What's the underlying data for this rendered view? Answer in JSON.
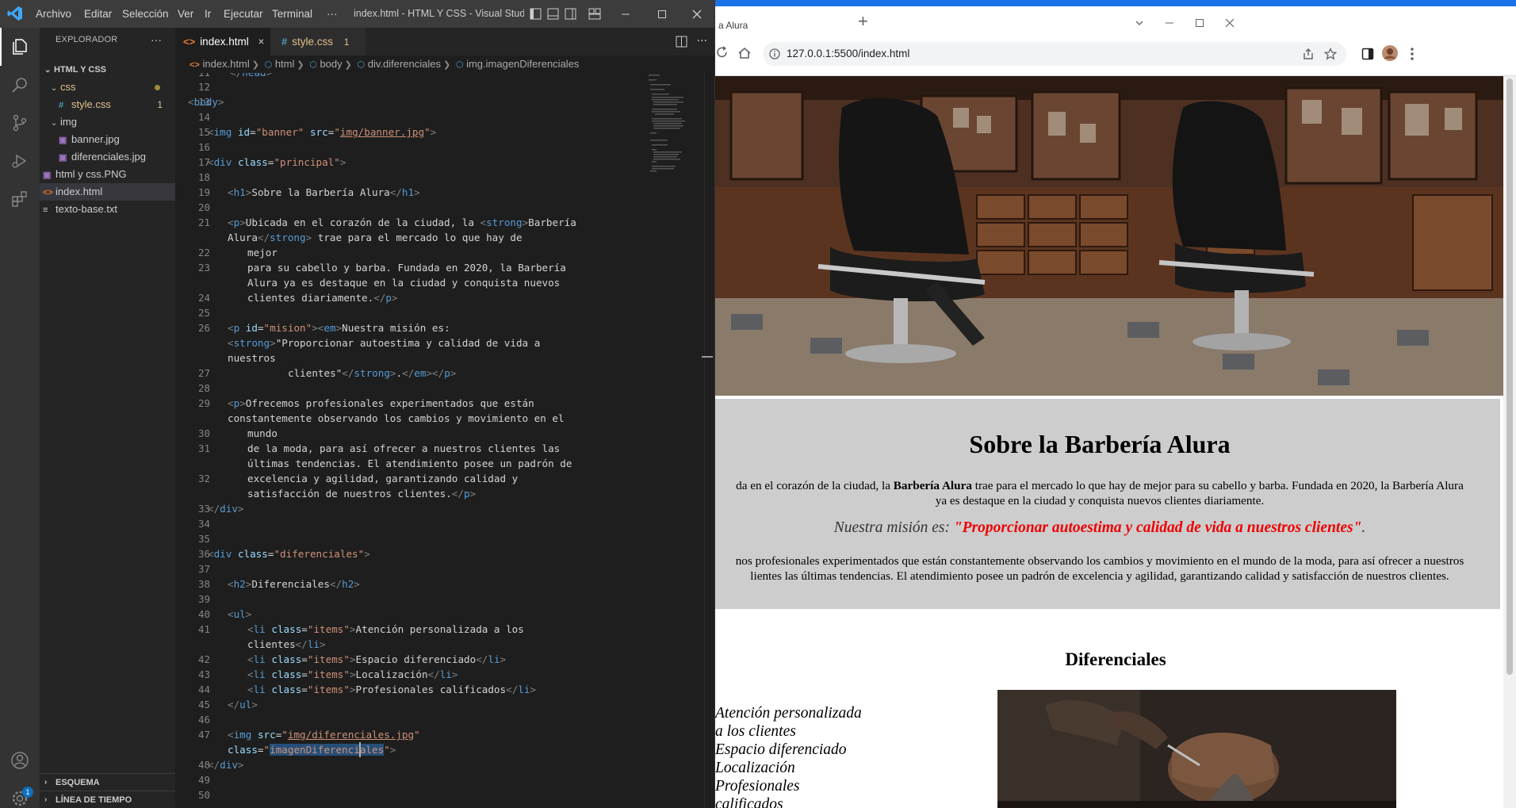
{
  "vscode": {
    "menu": [
      "Archivo",
      "Editar",
      "Selección",
      "Ver",
      "Ir",
      "Ejecutar",
      "Terminal",
      "···"
    ],
    "window_title": "index.html - HTML Y CSS - Visual Studi...",
    "sidebar": {
      "header": "EXPLORADOR",
      "more": "···",
      "root": "HTML Y CSS",
      "items": [
        {
          "label": "css",
          "type": "folder"
        },
        {
          "label": "style.css",
          "type": "css",
          "badge": "1"
        },
        {
          "label": "img",
          "type": "folder"
        },
        {
          "label": "banner.jpg",
          "type": "image"
        },
        {
          "label": "diferenciales.jpg",
          "type": "image"
        },
        {
          "label": "html y css.PNG",
          "type": "image"
        },
        {
          "label": "index.html",
          "type": "html"
        },
        {
          "label": "texto-base.txt",
          "type": "text"
        }
      ],
      "sections": [
        "ESQUEMA",
        "LÍNEA DE TIEMPO"
      ]
    },
    "tabs": [
      {
        "label": "index.html",
        "close": "×",
        "icon": "<>"
      },
      {
        "label": "style.css",
        "badge": "1",
        "icon": "#"
      }
    ],
    "breadcrumbs": [
      "index.html",
      "html",
      "body",
      "div.diferenciales",
      "img.imagenDiferenciales"
    ],
    "accounts_badge": "1",
    "colors": {
      "title_bar": "#3c3c3c",
      "activity_bar": "#333333",
      "sidebar": "#252526",
      "editor": "#1e1e1e",
      "accent": "#0e70c0"
    }
  },
  "chrome": {
    "tab_title": "a Alura",
    "new_tab": "+",
    "url": "127.0.0.1:5500/index.html",
    "page": {
      "h1": "Sobre la Barbería Alura",
      "p1_lead": "da en el corazón de la ciudad, la ",
      "p1_strong": "Barbería Alura",
      "p1_rest": " trae para el mercado lo que hay de mejor para su cabello y barba. Fundada en 2020, la Barbería Alura",
      "p1_line2": "ya es destaque en la ciudad y conquista nuevos clientes diariamente.",
      "mision_em": "Nuestra misión es: ",
      "mision_strong": "\"Proporcionar autoestima y calidad de vida a nuestros clientes\"",
      "mision_end": ".",
      "p3_line1": "nos profesionales experimentados que están constantemente observando los cambios y movimiento en el mundo de la moda, para así ofrecer a nuestros",
      "p3_line2": "lientes las últimas tendencias. El atendimiento posee un padrón de excelencia y agilidad, garantizando calidad y satisfacción de nuestros clientes.",
      "h2": "Diferenciales",
      "list": [
        "Atención personalizada",
        "a los clientes",
        "Espacio diferenciado",
        "Localización",
        "Profesionales",
        "calificados"
      ]
    }
  }
}
